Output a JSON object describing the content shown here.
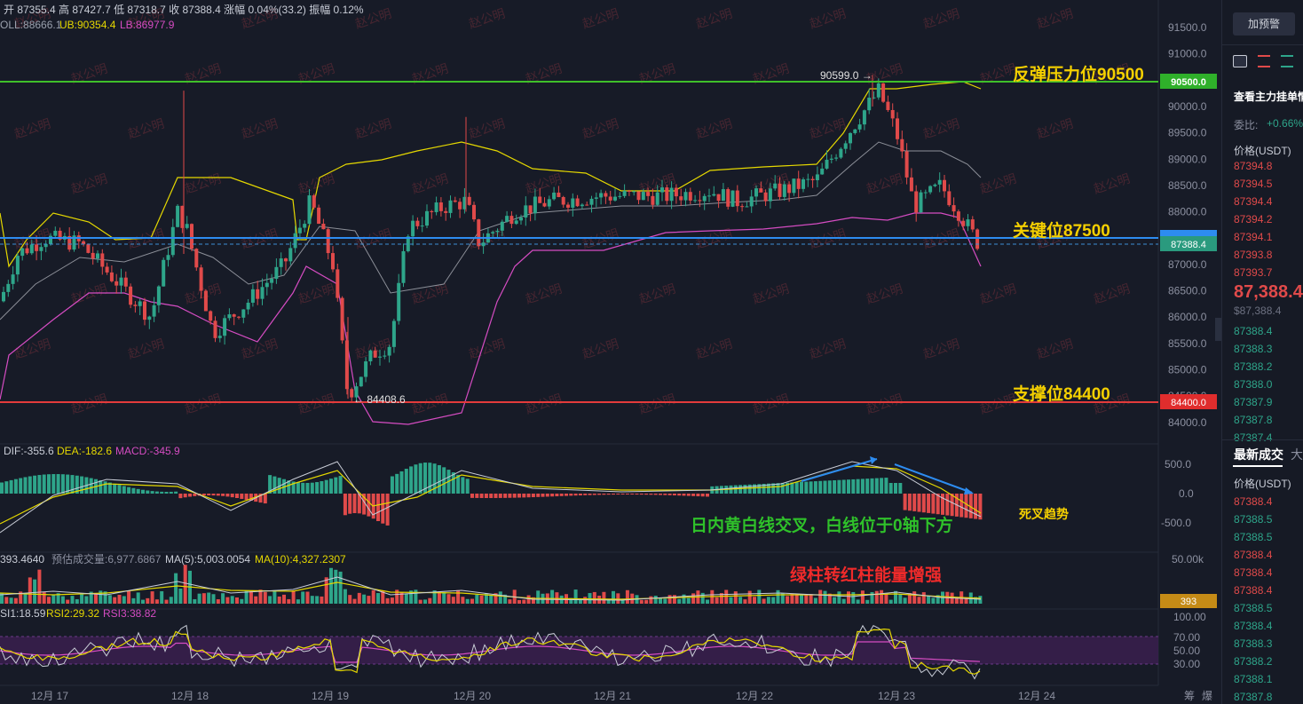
{
  "header": {
    "ohlc": "开 87355.4  高 87427.7  低 87318.7  收 87388.4  涨幅 0.04%(33.2)  振幅 0.12%",
    "boll_mid": "OLL:88666.1",
    "boll_ub": "UB:90354.4",
    "boll_lb": "LB:86977.9"
  },
  "watermark": "赵公明",
  "price_axis": [
    "91500.0",
    "91000.0",
    "90500.0",
    "90000.0",
    "89500.0",
    "89000.0",
    "88500.0",
    "88000.0",
    "87500.0",
    "87000.0",
    "86500.0",
    "86000.0",
    "85500.0",
    "85000.0",
    "84500.0",
    "84000.0"
  ],
  "levels": {
    "resistance_label": "反弹压力位90500",
    "resistance_tag": "90500.0",
    "key_label": "关键位87500",
    "key_tag": "87500.0",
    "current_tag": "87388.4",
    "support_label": "支撑位84400",
    "support_tag": "84400.0"
  },
  "peak_note": "90599.0 →",
  "low_note": "← 84408.6",
  "macd": {
    "dif": "DIF:-355.6",
    "dea": "DEA:-182.6",
    "macd": "MACD:-345.9",
    "axis": [
      "500.0",
      "0.0",
      "-500.0"
    ],
    "annot_cross": "日内黄白线交叉，白线位于0轴下方",
    "annot_trend": "死叉趋势"
  },
  "volume": {
    "vol": "393.4640",
    "est": "预估成交量:6,977.6867",
    "ma5": "MA(5):5,003.0054",
    "ma10": "MA(10):4,327.2307",
    "axis_top": "50.00k",
    "tag": "393",
    "annot": "绿柱转红柱能量增强"
  },
  "rsi": {
    "rsi1": "SI1:18.59",
    "rsi2": "RSI2:29.32",
    "rsi3": "RSI3:38.82",
    "axis": [
      "100.00",
      "70.00",
      "50.00",
      "30.00"
    ]
  },
  "time_axis": [
    "12月 17",
    "12月 18",
    "12月 19",
    "12月 20",
    "12月 21",
    "12月 22",
    "12月 23",
    "12月 24"
  ],
  "corner": {
    "chip": "筹",
    "burst": "爆"
  },
  "colors": {
    "up": "#2ea58a",
    "down": "#e04a4a",
    "resistance": "#3fbf2a",
    "key": "#2d8cf0",
    "support": "#e33b3b",
    "ub": "#e5d800",
    "lb": "#d54cc2",
    "mid": "#8c8f98",
    "annot_yellow": "#f5d000",
    "annot_green": "#2fc12a",
    "annot_red": "#f02a2a"
  },
  "sidebar": {
    "button": "加预警",
    "title": "查看主力挂单情",
    "ratio_label": "委比:",
    "ratio_value": "+0.66%",
    "ask_header": "价格(USDT)",
    "asks": [
      "87394.8",
      "87394.5",
      "87394.4",
      "87394.2",
      "87394.1",
      "87393.8",
      "87393.7"
    ],
    "last_price": "87,388.4",
    "last_price_usd": "$87,388.4",
    "bids": [
      "87388.4",
      "87388.3",
      "87388.2",
      "87388.0",
      "87387.9",
      "87387.8",
      "87387.4"
    ],
    "trades_tab": "最新成交",
    "trades_tab2": "大",
    "trades_header": "价格(USDT)",
    "trades": [
      "87388.4",
      "87388.5",
      "87388.5",
      "87388.4",
      "87388.4",
      "87388.4",
      "87388.5",
      "87388.4",
      "87388.3",
      "87388.2",
      "87388.1",
      "87387.8"
    ],
    "trade_sides": [
      "down",
      "up",
      "up",
      "down",
      "down",
      "down",
      "up",
      "up",
      "up",
      "up",
      "up",
      "up"
    ]
  }
}
